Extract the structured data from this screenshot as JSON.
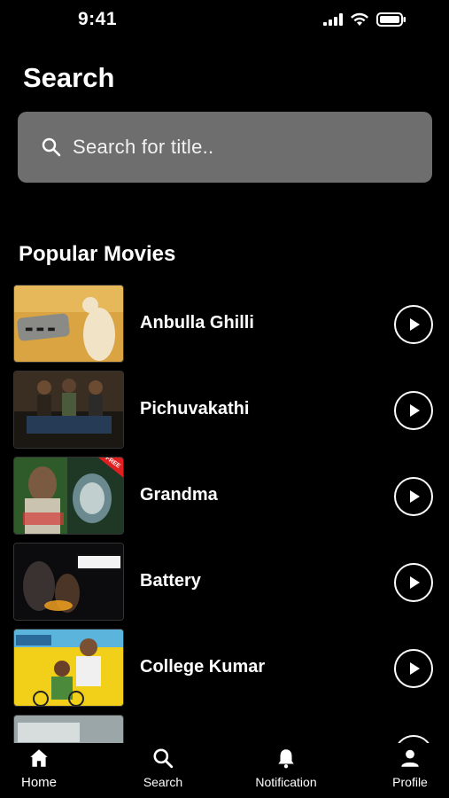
{
  "status_bar": {
    "time": "9:41"
  },
  "header": {
    "title": "Search"
  },
  "search": {
    "placeholder": "Search for title.."
  },
  "section": {
    "title": "Popular Movies"
  },
  "movies": [
    {
      "title": "Anbulla Ghilli"
    },
    {
      "title": "Pichuvakathi"
    },
    {
      "title": "Grandma",
      "badge": "FREE"
    },
    {
      "title": "Battery"
    },
    {
      "title": "College Kumar"
    }
  ],
  "nav": [
    {
      "label": "Home",
      "icon": "home-icon"
    },
    {
      "label": "Search",
      "icon": "search-icon"
    },
    {
      "label": "Notification",
      "icon": "bell-icon"
    },
    {
      "label": "Profile",
      "icon": "person-icon"
    }
  ]
}
